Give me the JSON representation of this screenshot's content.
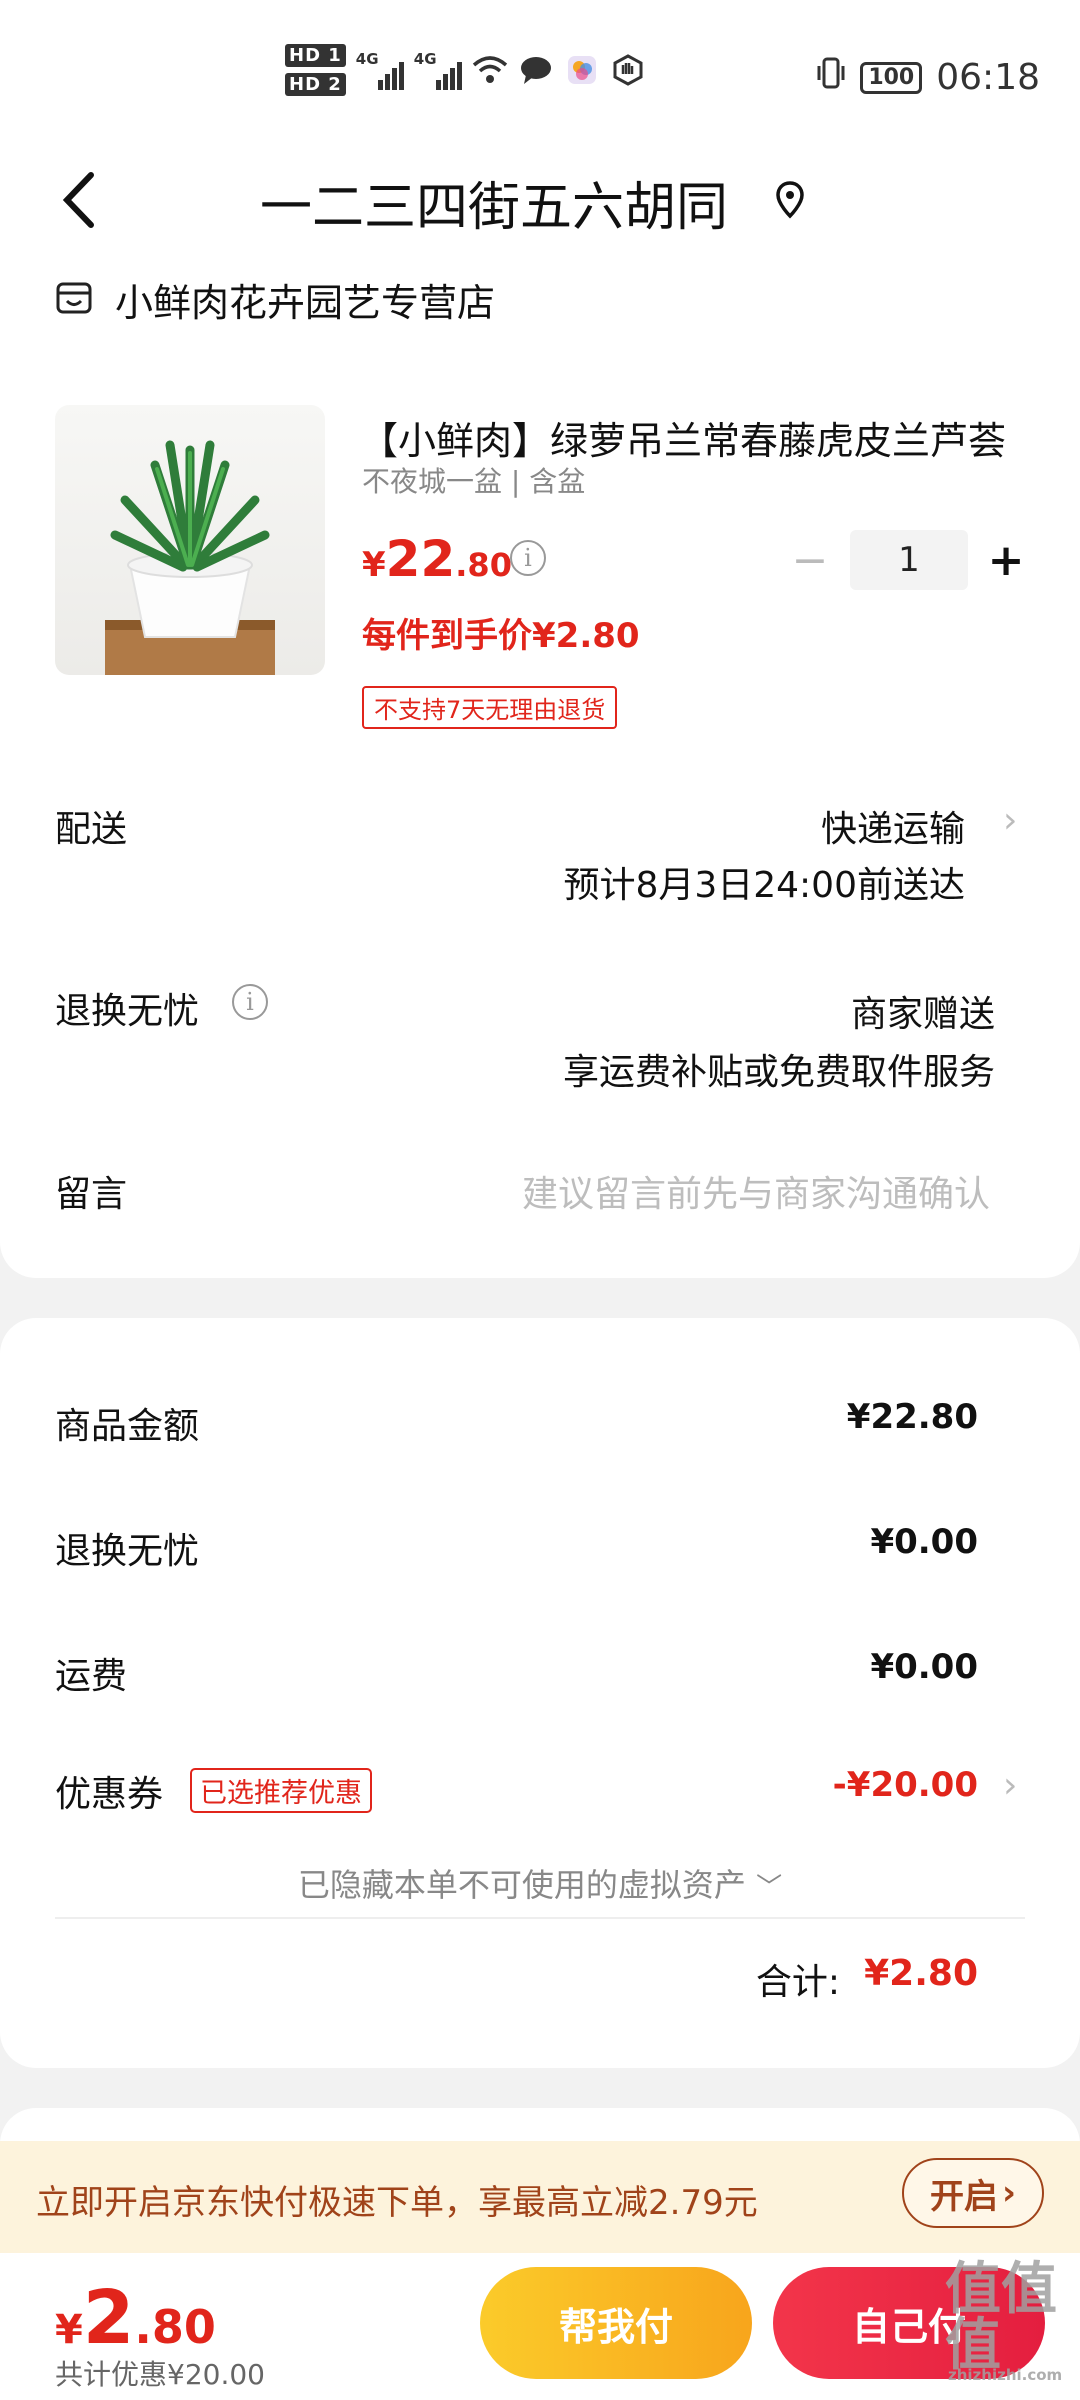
{
  "status_bar": {
    "hd1": "HD 1",
    "hd2": "HD 2",
    "signal1": "4G",
    "signal2": "4G",
    "battery": "100",
    "time": "06:18"
  },
  "header": {
    "title": "一二三四街五六胡同"
  },
  "shop": {
    "name": "小鲜肉花卉园艺专营店"
  },
  "product": {
    "title": "【小鲜肉】绿萝吊兰常春藤虎皮兰芦荟",
    "spec": "不夜城一盆 | 含盆",
    "price_symbol": "¥",
    "price_int": "22",
    "price_dec": ".80",
    "quantity": "1",
    "unit_price": "每件到手价¥2.80",
    "return_tag": "不支持7天无理由退货"
  },
  "delivery": {
    "label": "配送",
    "method": "快递运输",
    "eta": "预计8月3日24:00前送达"
  },
  "return_worry_free": {
    "label": "退换无忧",
    "value": "商家赠送",
    "desc": "享运费补贴或免费取件服务"
  },
  "note": {
    "label": "留言",
    "placeholder": "建议留言前先与商家沟通确认"
  },
  "summary": {
    "goods_label": "商品金额",
    "goods_value": "¥22.80",
    "return_label": "退换无忧",
    "return_value": "¥0.00",
    "shipping_label": "运费",
    "shipping_value": "¥0.00",
    "coupon_label": "优惠券",
    "coupon_tag": "已选推荐优惠",
    "coupon_value": "-¥20.00",
    "hidden_assets": "已隐藏本单不可使用的虚拟资产",
    "total_label": "合计:",
    "total_value": "¥2.80"
  },
  "promo": {
    "text": "立即开启京东快付极速下单，享最高立减2.79元",
    "button": "开启"
  },
  "bottom_bar": {
    "price_symbol": "¥",
    "price_int": "2",
    "price_dec": ".80",
    "discount": "共计优惠¥20.00",
    "help_pay": "帮我付",
    "self_pay": "自己付"
  },
  "watermark": {
    "text": "值值值",
    "sub": "zhizhizhi.com"
  },
  "colors": {
    "accent_red": "#e1251b",
    "promo_bg": "#fdf3dc",
    "help_btn": "#f8a51c",
    "self_btn": "#e41e3f"
  }
}
